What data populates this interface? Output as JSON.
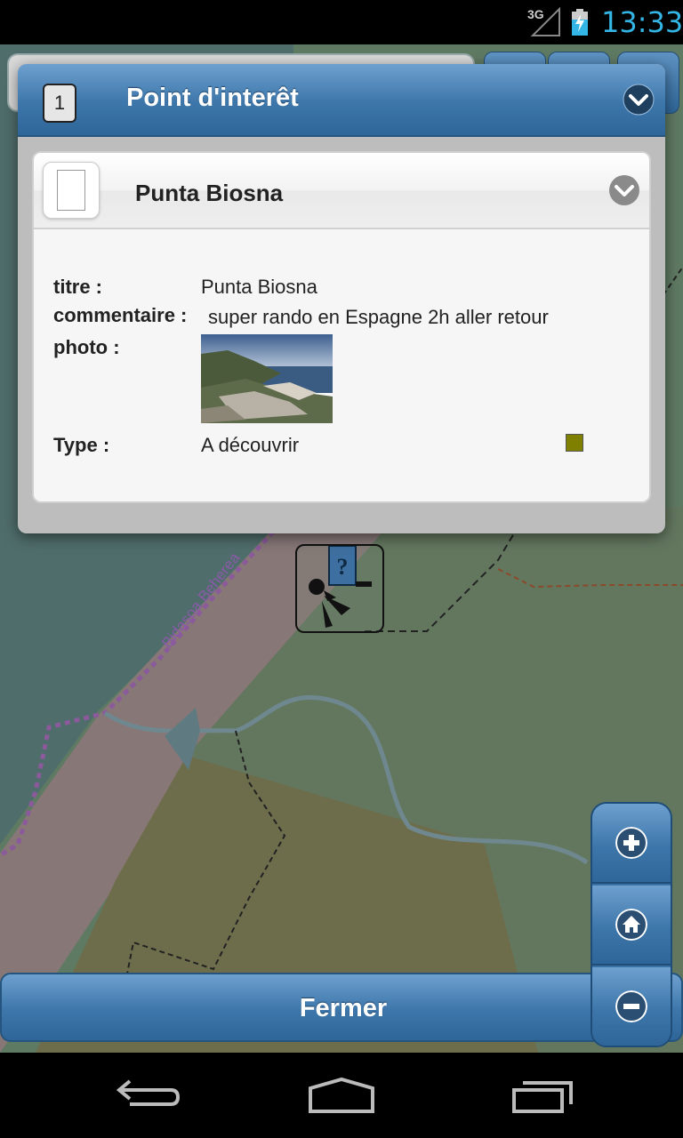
{
  "status_bar": {
    "network": "3G",
    "time": "13:33"
  },
  "popup": {
    "count": "1",
    "title": "Point d'interêt",
    "card": {
      "title": "Punta Biosna",
      "fields": {
        "titre_label": "titre :",
        "titre_value": "Punta Biosna",
        "commentaire_label": "commentaire :",
        "commentaire_value": "super rando en Espagne 2h aller retour",
        "photo_label": "photo :",
        "type_label": "Type :",
        "type_value": "A découvrir",
        "type_color": "#7f7f00"
      }
    }
  },
  "map": {
    "label": "Bidasoa Beherea"
  },
  "zoom": {
    "in_icon": "plus-icon",
    "home_icon": "home-icon",
    "out_icon": "minus-icon"
  },
  "footer": {
    "close_label": "Fermer"
  },
  "nav": {
    "back_icon": "back-icon",
    "home_icon": "home-outline-icon",
    "recents_icon": "recent-apps-icon"
  }
}
